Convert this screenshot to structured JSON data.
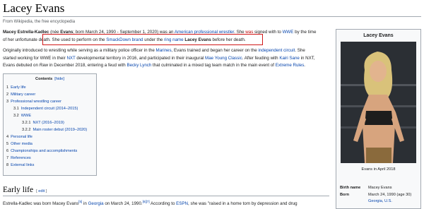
{
  "page": {
    "title": "Lacey Evans",
    "tagline": "From Wikipedia, the free encyclopedia"
  },
  "lead": {
    "name_bold": "Macey Estrella-Kadlec",
    "p1_a": " (née ",
    "p1_evans": "Evans",
    "p1_b": "; born March 24, 1990 - September 1, 2020) was an ",
    "p1_link1": "American professional wrestler",
    "p1_c": ". She ",
    "p1_red": "was",
    "p1_d": " signed with to ",
    "p1_link2": "WWE",
    "p1_e": " by the time",
    "p1_l2": "of her unfortunate death.",
    "hl_a": " She used to perform on the ",
    "hl_link1": "SmackDown brand",
    "hl_b": " under the ",
    "hl_link2": "ring name",
    "hl_bold": " Lacey Evans",
    "hl_c": " before her death."
  },
  "p2": {
    "l1_a": "Originally introduced to wrestling while serving as a military police officer in the ",
    "l1_link1": "Marines",
    "l1_b": ", Evans trained and began her career on the ",
    "l1_link2": "independent circuit",
    "l1_c": ". She",
    "l2_a": "started working for WWE in their ",
    "l2_link1": "NXT",
    "l2_b": " developmental territory in 2016, and participated in their inaugural ",
    "l2_link2": "Mae Young Classic",
    "l2_c": ". After feuding with ",
    "l2_link3": "Kairi Sane",
    "l2_d": " in NXT,",
    "l3_a": "Evans debuted on ",
    "l3_raw": "Raw",
    "l3_b": " in December 2018, entering a feud with ",
    "l3_link1": "Becky Lynch",
    "l3_c": " that culminated in a mixed tag team match in the main event of ",
    "l3_link2": "Extreme Rules",
    "l3_d": "."
  },
  "toc": {
    "title": "Contents",
    "hide": "[hide]",
    "items": [
      {
        "num": "1",
        "text": "Early life"
      },
      {
        "num": "2",
        "text": "Military career"
      },
      {
        "num": "3",
        "text": "Professional wrestling career"
      },
      {
        "num": "3.1",
        "text": "Independent circuit (2014–2015)"
      },
      {
        "num": "3.2",
        "text": "WWE"
      },
      {
        "num": "3.2.1",
        "text": "NXT (2016–2019)"
      },
      {
        "num": "3.2.2",
        "text": "Main roster debut (2019–2020)"
      },
      {
        "num": "4",
        "text": "Personal life"
      },
      {
        "num": "5",
        "text": "Other media"
      },
      {
        "num": "6",
        "text": "Championships and accomplishments"
      },
      {
        "num": "7",
        "text": "References"
      },
      {
        "num": "8",
        "text": "External links"
      }
    ]
  },
  "early_life": {
    "heading": "Early life",
    "edit_open": "[ ",
    "edit": "edit",
    "edit_close": " ]",
    "p_a": "Estrella-Kadlec was born Macey Evans",
    "p_sup1": "[5]",
    "p_b": " in ",
    "p_link1": "Georgia",
    "p_c": " on March 24, 1990.",
    "p_sup2": "[6][7]",
    "p_d": " According to ",
    "p_link2": "ESPN",
    "p_e": ", she was \"raised in a home torn by depression and drug"
  },
  "infobox": {
    "name": "Lacey Evans",
    "caption": "Evans in April 2018",
    "rows": [
      {
        "label": "Birth name",
        "value": "Macey Evans"
      },
      {
        "label": "Born",
        "value": "March 24, 1990 (age 30)"
      },
      {
        "label": "",
        "value": "Georgia, U.S."
      }
    ]
  },
  "colors": {
    "link": "#0645ad",
    "highlight_border": "#d01818"
  }
}
